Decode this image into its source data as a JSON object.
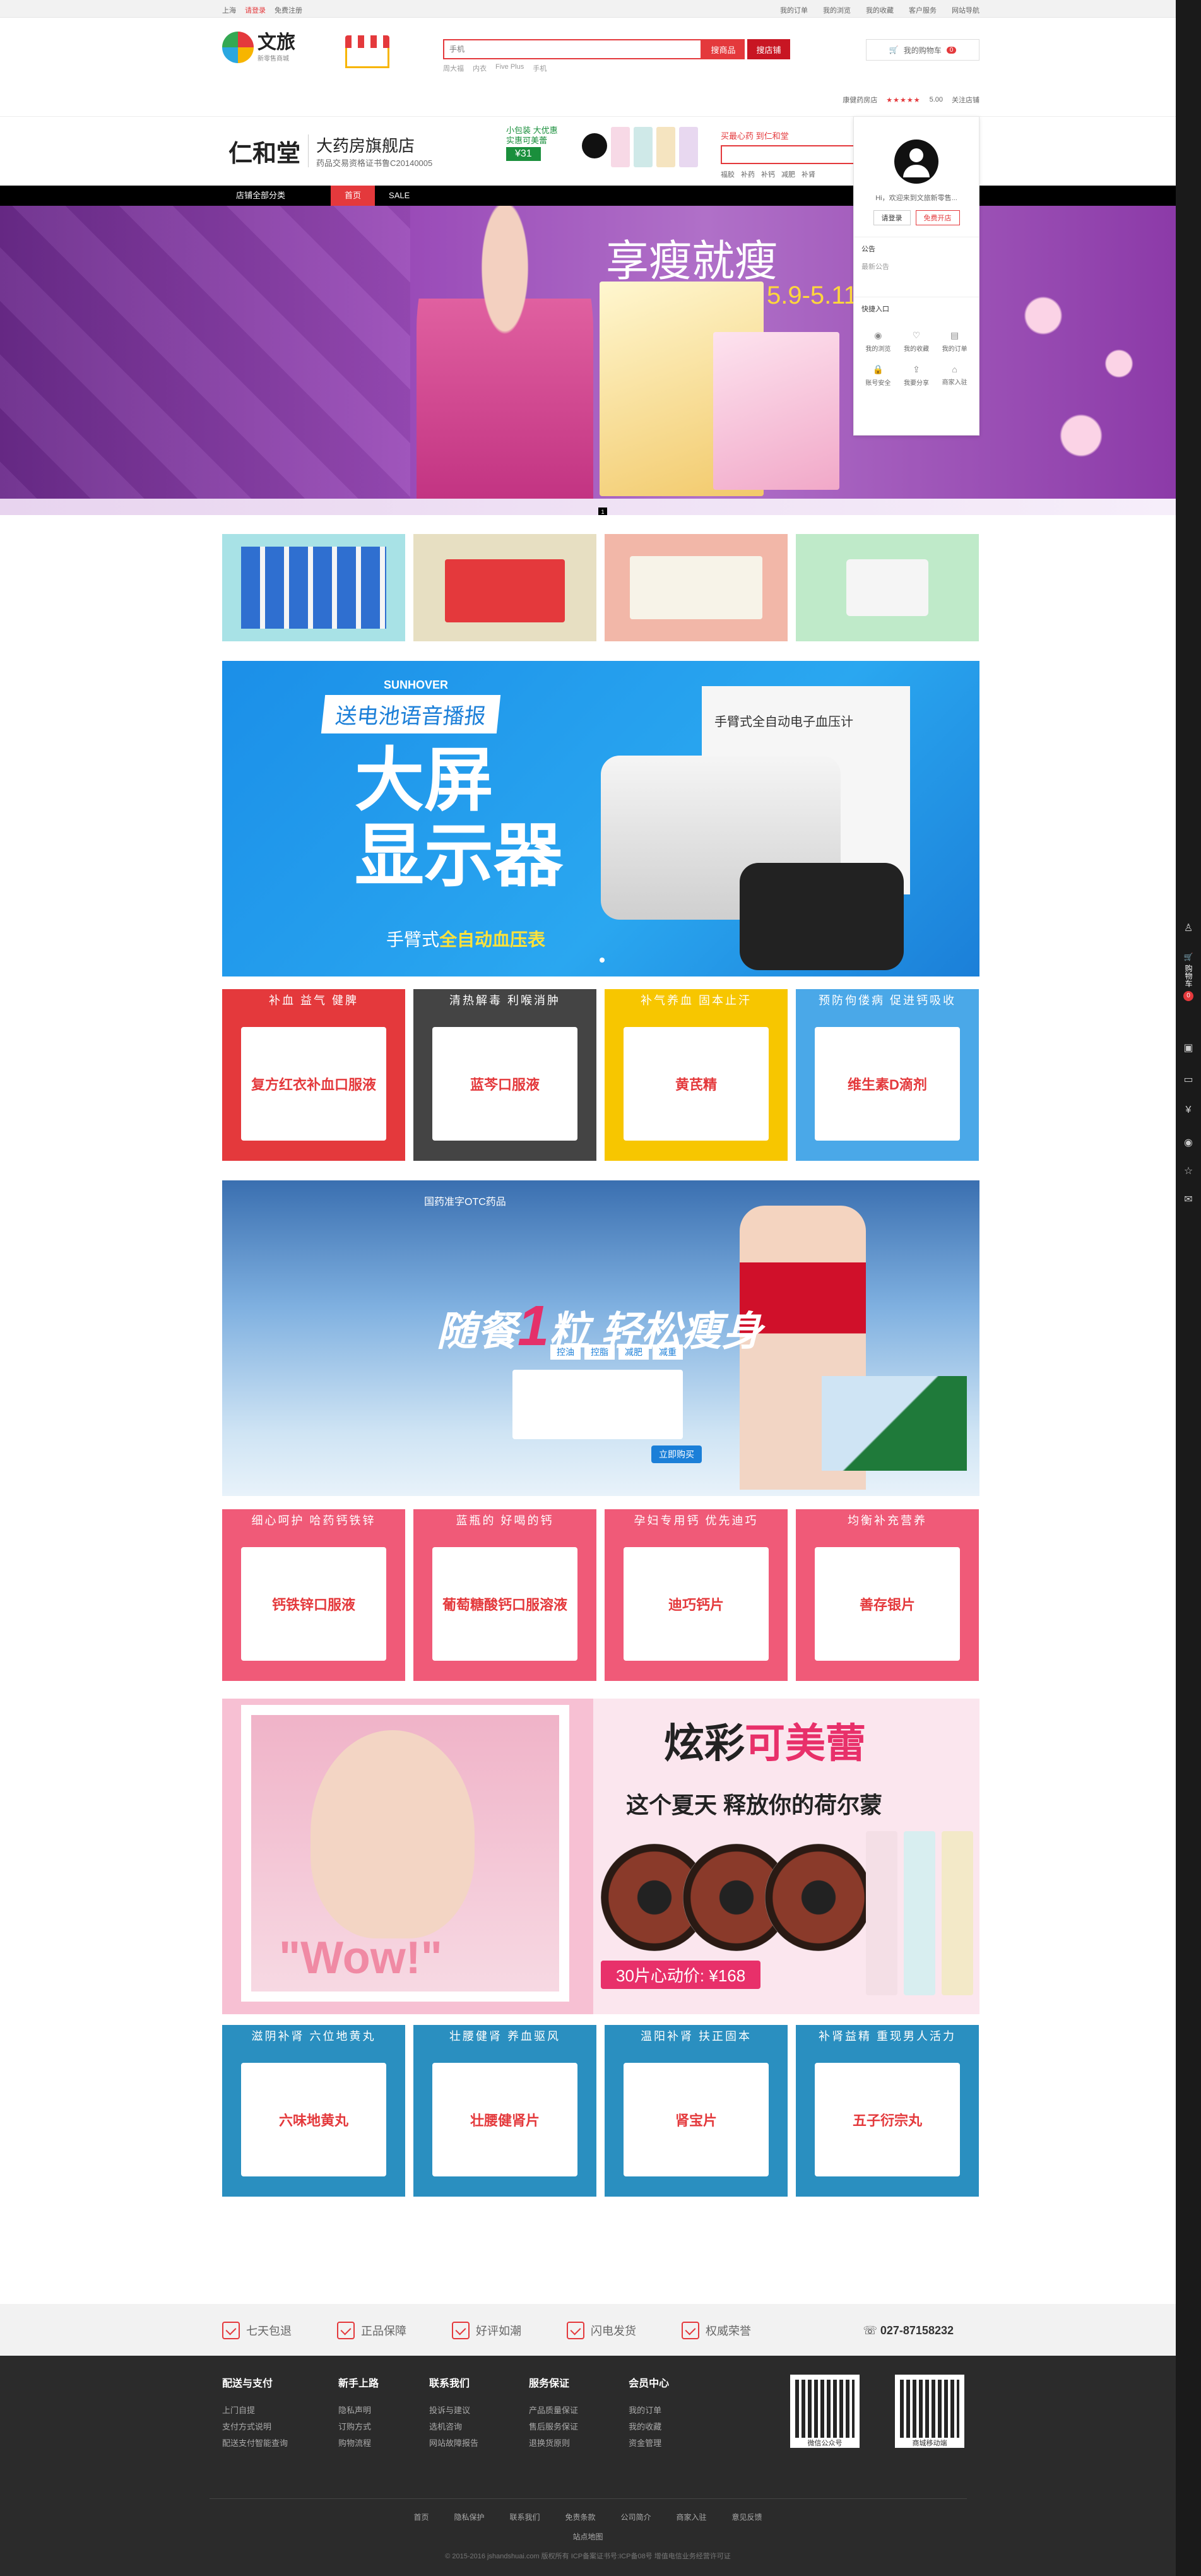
{
  "topbar": {
    "location": "上海",
    "login": "请登录",
    "register": "免费注册",
    "links": [
      "我的订单",
      "我的浏览",
      "我的收藏",
      "客户服务",
      "网站导航"
    ]
  },
  "header": {
    "logo_name": "文旅",
    "logo_sub": "新零售商城",
    "search_placeholder": "手机",
    "search_btn": "搜商品",
    "search_shop_btn": "搜店铺",
    "hot_words": [
      "周大福",
      "内衣",
      "Five Plus",
      "手机"
    ],
    "cart_label": "我的购物车",
    "cart_count": "0"
  },
  "shopinfo": {
    "name": "康健药房店",
    "rating": "5.00",
    "follow": "关注店铺"
  },
  "store": {
    "brand": "仁和堂",
    "title": "大药房旗舰店",
    "license": "药品交易资格证书鲁C20140005",
    "promo_line1": "小包装 大优惠",
    "promo_line2": "实惠可美蕾",
    "promo_price": "¥31",
    "search_title": "买最心药 到仁和堂",
    "search_tags": [
      "福胶",
      "补药",
      "补钙",
      "减肥",
      "补肾"
    ]
  },
  "nav": {
    "items": [
      "店铺全部分类",
      "首页",
      "SALE"
    ]
  },
  "popup": {
    "greeting": "Hi，欢迎来到文旅新零售...",
    "login": "请登录",
    "register": "免费开店",
    "notice_title": "公告",
    "notice_item": "最新公告",
    "quick_title": "快捷入口",
    "quick": [
      "我的浏览",
      "我的收藏",
      "我的订单",
      "账号安全",
      "我要分享",
      "商家入驻"
    ]
  },
  "hero": {
    "title": "享瘦就瘦",
    "date": "5.9-5.11",
    "page": "1"
  },
  "banner_bp": {
    "brand": "SUNHOVER",
    "tag": "送电池语音播报",
    "big_line1": "大屏",
    "big_line2": "显示器",
    "sub_a": "手臂式",
    "sub_b": "全自动血压表",
    "box_title": "手臂式全自动电子血压计"
  },
  "cat_row1": [
    {
      "title": "补血 益气 健脾",
      "product": "复方红衣补血口服液",
      "color": "#e4393c"
    },
    {
      "title": "清热解毒 利喉消肿",
      "product": "蓝芩口服液",
      "color": "#444444"
    },
    {
      "title": "补气养血 固本止汗",
      "product": "黄芪精",
      "color": "#f7c600"
    },
    {
      "title": "预防佝偻病 促进钙吸收",
      "product": "维生素D滴剂",
      "color": "#4aa8e8"
    }
  ],
  "banner_winter": {
    "top": "国药准字OTC药品",
    "main_a": "随餐",
    "main_num": "1",
    "main_b": "粒 轻松瘦身",
    "tags": [
      "控油",
      "控脂",
      "减肥",
      "减重"
    ],
    "buy": "立即购买"
  },
  "cat_row2": [
    {
      "title": "细心呵护 哈药钙铁锌",
      "product": "钙铁锌口服液",
      "color": "#f05a78"
    },
    {
      "title": "蓝瓶的 好喝的钙",
      "product": "葡萄糖酸钙口服溶液",
      "color": "#f05a78"
    },
    {
      "title": "孕妇专用钙 优先迪巧",
      "product": "迪巧钙片",
      "color": "#f05a78"
    },
    {
      "title": "均衡补充营养",
      "product": "善存银片",
      "color": "#f05a78"
    }
  ],
  "banner_lens": {
    "wow": "\"Wow!\"",
    "headline_a": "炫彩",
    "headline_b": "可美蕾",
    "sub": "这个夏天 释放你的荷尔蒙",
    "price": "30片心动价: ¥168"
  },
  "cat_row3": [
    {
      "title": "滋阴补肾 六位地黄丸",
      "product": "六味地黄丸",
      "color": "#2a8fc0"
    },
    {
      "title": "壮腰健肾 养血驱风",
      "product": "壮腰健肾片",
      "color": "#2a8fc0"
    },
    {
      "title": "温阳补肾 扶正固本",
      "product": "肾宝片",
      "color": "#2a8fc0"
    },
    {
      "title": "补肾益精 重现男人活力",
      "product": "五子衍宗丸",
      "color": "#2a8fc0"
    }
  ],
  "footbar": {
    "items": [
      "七天包退",
      "正品保障",
      "好评如潮",
      "闪电发货",
      "权威荣誉"
    ],
    "phone": "027-87158232"
  },
  "footer": {
    "cols": [
      {
        "title": "配送与支付",
        "items": [
          "上门自提",
          "支付方式说明",
          "配送支付智能查询"
        ]
      },
      {
        "title": "新手上路",
        "items": [
          "隐私声明",
          "订购方式",
          "购物流程"
        ]
      },
      {
        "title": "联系我们",
        "items": [
          "投诉与建议",
          "选机咨询",
          "网站故障报告"
        ]
      },
      {
        "title": "服务保证",
        "items": [
          "产品质量保证",
          "售后服务保证",
          "退换货原则"
        ]
      },
      {
        "title": "会员中心",
        "items": [
          "我的订单",
          "我的收藏",
          "资金管理"
        ]
      }
    ],
    "qr1": "微信公众号",
    "qr2": "商城移动端",
    "links": [
      "首页",
      "隐私保护",
      "联系我们",
      "免责条款",
      "公司简介",
      "商家入驻",
      "意见反馈"
    ],
    "sitemap": "站点地图",
    "copyright": "© 2015-2016 jshandshuai.com 版权所有 ICP备案证书号:ICP备08号 增值电信业务经营许可证"
  },
  "sidebar": {
    "cart": "购物车",
    "count": "0"
  }
}
